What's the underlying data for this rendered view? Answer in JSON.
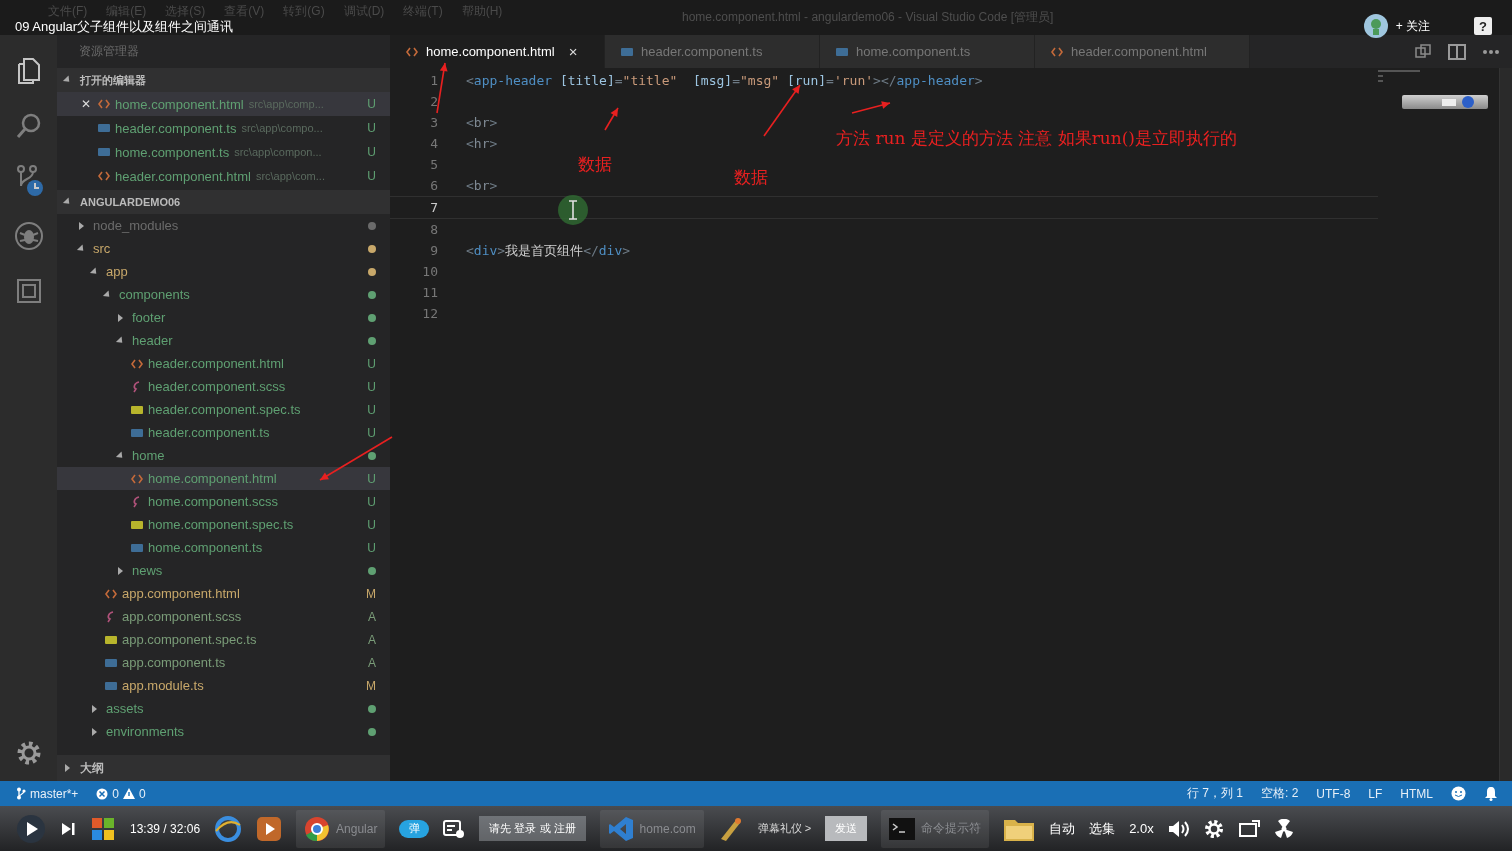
{
  "video": {
    "title": "09 Angular父子组件以及组件之间通讯",
    "follow": "+ 关注",
    "help": "?"
  },
  "window": {
    "menu": [
      "文件(F)",
      "编辑(E)",
      "选择(S)",
      "查看(V)",
      "转到(G)",
      "调试(D)",
      "终端(T)",
      "帮助(H)"
    ],
    "title": "home.component.html - angulardemo06 - Visual Studio Code [管理员]"
  },
  "activity_bar": [
    {
      "kind": "explorer",
      "selected": true
    },
    {
      "kind": "search",
      "selected": false
    },
    {
      "kind": "scm",
      "selected": false
    },
    {
      "kind": "debug",
      "selected": false
    },
    {
      "kind": "extensions",
      "selected": false
    }
  ],
  "sidebar": {
    "title": "资源管理器",
    "open_editors": {
      "label": "打开的编辑器",
      "expanded": true,
      "items": [
        {
          "name": "home.component.html",
          "path": "src\\app\\comp...",
          "kind": "html",
          "badge": "U",
          "selected": true,
          "close": "✕"
        },
        {
          "name": "header.component.ts",
          "path": "src\\app\\compo...",
          "kind": "ts",
          "badge": "U",
          "selected": false
        },
        {
          "name": "home.component.ts",
          "path": "src\\app\\compon...",
          "kind": "ts",
          "badge": "U",
          "selected": false
        },
        {
          "name": "header.component.html",
          "path": "src\\app\\com...",
          "kind": "html",
          "badge": "U",
          "selected": false
        }
      ]
    },
    "project": {
      "label": "ANGULARDEMO06",
      "expanded": true,
      "children": [
        {
          "name": "node_modules",
          "kind": "folder",
          "expanded": false,
          "color": "#6b6b6b"
        },
        {
          "name": "src",
          "kind": "folder",
          "expanded": true,
          "color": "#c8a86a",
          "children": [
            {
              "name": "app",
              "kind": "folder",
              "expanded": true,
              "color": "#c8a86a",
              "children": [
                {
                  "name": "components",
                  "kind": "folder",
                  "expanded": true,
                  "color": "#5fa072",
                  "children": [
                    {
                      "name": "footer",
                      "kind": "folder",
                      "expanded": false,
                      "color": "#5fa072"
                    },
                    {
                      "name": "header",
                      "kind": "folder",
                      "expanded": true,
                      "color": "#5fa072",
                      "children": [
                        {
                          "name": "header.component.html",
                          "kind": "html",
                          "color": "#5fa072",
                          "badge": "U",
                          "selected": false
                        },
                        {
                          "name": "header.component.scss",
                          "kind": "scss",
                          "color": "#5fa072",
                          "badge": "U",
                          "selected": false
                        },
                        {
                          "name": "header.component.spec.ts",
                          "kind": "spec",
                          "color": "#5fa072",
                          "badge": "U",
                          "selected": false
                        },
                        {
                          "name": "header.component.ts",
                          "kind": "ts",
                          "color": "#5fa072",
                          "badge": "U",
                          "selected": false
                        }
                      ]
                    },
                    {
                      "name": "home",
                      "kind": "folder",
                      "expanded": true,
                      "color": "#5fa072",
                      "children": [
                        {
                          "name": "home.component.html",
                          "kind": "html",
                          "color": "#5fa072",
                          "badge": "U",
                          "selected": true
                        },
                        {
                          "name": "home.component.scss",
                          "kind": "scss",
                          "color": "#5fa072",
                          "badge": "U",
                          "selected": false
                        },
                        {
                          "name": "home.component.spec.ts",
                          "kind": "spec",
                          "color": "#5fa072",
                          "badge": "U",
                          "selected": false
                        },
                        {
                          "name": "home.component.ts",
                          "kind": "ts",
                          "color": "#5fa072",
                          "badge": "U",
                          "selected": false
                        }
                      ]
                    },
                    {
                      "name": "news",
                      "kind": "folder",
                      "expanded": false,
                      "color": "#5fa072"
                    }
                  ]
                },
                {
                  "name": "app.component.html",
                  "kind": "html",
                  "color": "#c8a86a",
                  "badge": "M",
                  "selected": false
                },
                {
                  "name": "app.component.scss",
                  "kind": "scss",
                  "color": "#7a9c78",
                  "badge": "A",
                  "selected": false
                },
                {
                  "name": "app.component.spec.ts",
                  "kind": "spec",
                  "color": "#7a9c78",
                  "badge": "A",
                  "selected": false
                },
                {
                  "name": "app.component.ts",
                  "kind": "ts",
                  "color": "#7a9c78",
                  "badge": "A",
                  "selected": false
                },
                {
                  "name": "app.module.ts",
                  "kind": "ts",
                  "color": "#c8a86a",
                  "badge": "M",
                  "selected": false
                }
              ]
            },
            {
              "name": "assets",
              "kind": "folder",
              "expanded": false,
              "color": "#5fa072"
            },
            {
              "name": "environments",
              "kind": "folder",
              "expanded": false,
              "color": "#5fa072"
            }
          ]
        }
      ]
    },
    "outline": {
      "label": "大纲",
      "expanded": false
    }
  },
  "editor": {
    "tabs": [
      {
        "name": "home.component.html",
        "kind": "html",
        "selected": true,
        "close": "×"
      },
      {
        "name": "header.component.ts",
        "kind": "ts",
        "selected": false
      },
      {
        "name": "home.component.ts",
        "kind": "ts",
        "selected": false
      },
      {
        "name": "header.component.html",
        "kind": "html",
        "selected": false
      }
    ],
    "lines": [
      {
        "n": "1",
        "current": false,
        "tokens": [
          {
            "kind": "punct",
            "t": "<"
          },
          {
            "kind": "tag",
            "t": "app-header"
          },
          {
            "kind": "attr",
            "t": " [title]"
          },
          {
            "kind": "punct",
            "t": "="
          },
          {
            "kind": "str",
            "t": "\"title\""
          },
          {
            "kind": "attr",
            "t": "  [msg]"
          },
          {
            "kind": "punct",
            "t": "="
          },
          {
            "kind": "str",
            "t": "\"msg\""
          },
          {
            "kind": "attr",
            "t": " [run]"
          },
          {
            "kind": "punct",
            "t": "="
          },
          {
            "kind": "str",
            "t": "'run'"
          },
          {
            "kind": "punct",
            "t": "></"
          },
          {
            "kind": "tag",
            "t": "app-header"
          },
          {
            "kind": "punct",
            "t": ">"
          }
        ]
      },
      {
        "n": "2",
        "current": false
      },
      {
        "n": "3",
        "current": false,
        "tokens": [
          {
            "kind": "punct",
            "t": "<"
          },
          {
            "kind": "tag2",
            "t": "br"
          },
          {
            "kind": "punct",
            "t": ">"
          }
        ]
      },
      {
        "n": "4",
        "current": false,
        "tokens": [
          {
            "kind": "punct",
            "t": "<"
          },
          {
            "kind": "tag2",
            "t": "hr"
          },
          {
            "kind": "punct",
            "t": ">"
          }
        ]
      },
      {
        "n": "5",
        "current": false
      },
      {
        "n": "6",
        "current": false,
        "tokens": [
          {
            "kind": "punct",
            "t": "<"
          },
          {
            "kind": "tag2",
            "t": "br"
          },
          {
            "kind": "punct",
            "t": ">"
          }
        ]
      },
      {
        "n": "7",
        "current": true
      },
      {
        "n": "8",
        "current": false
      },
      {
        "n": "9",
        "current": false,
        "tokens": [
          {
            "kind": "punct",
            "t": "<"
          },
          {
            "kind": "tag",
            "t": "div"
          },
          {
            "kind": "punct",
            "t": ">"
          },
          {
            "kind": "text",
            "t": "我是首页组件"
          },
          {
            "kind": "punct",
            "t": "</"
          },
          {
            "kind": "tag",
            "t": "div"
          },
          {
            "kind": "punct",
            "t": ">"
          }
        ]
      },
      {
        "n": "10",
        "current": false
      },
      {
        "n": "11",
        "current": false
      },
      {
        "n": "12",
        "current": false
      }
    ]
  },
  "annotations": [
    {
      "text": "数据"
    },
    {
      "text": "数据"
    },
    {
      "text": "方法 run 是定义的方法 注意 如果run()是立即执行的"
    }
  ],
  "status_bar": {
    "branch": "master*+",
    "errors": "0",
    "warnings": "0",
    "position": "行 7，列 1",
    "indent": "空格: 2",
    "encoding": "UTF-8",
    "eol": "LF",
    "language": "HTML"
  },
  "player": {
    "time": "13:39 / 32:06",
    "danmaku_toggle": "弹",
    "danmaku_placeholder": "请先 登录 或 注册",
    "etiquette": "弹幕礼仪 >",
    "send": "发送",
    "quality": "自动",
    "episodes": "选集",
    "speed": "2.0x",
    "taskbar": [
      {
        "kind": "chrome",
        "label": "Angular"
      },
      {
        "kind": "vscode",
        "label": "home.com"
      },
      {
        "kind": "cmd",
        "label": "命令提示符"
      }
    ]
  }
}
